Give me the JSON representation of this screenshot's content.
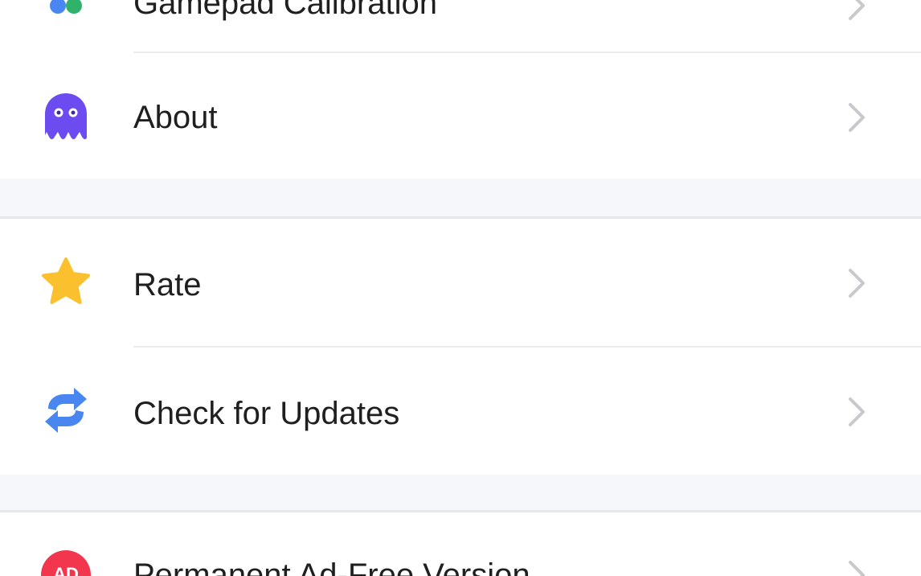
{
  "settings": {
    "rows": [
      {
        "label": "Gamepad Calibration",
        "icon": "gamepad-icon"
      },
      {
        "label": "About",
        "icon": "ghost-icon",
        "icon_color": "#6c4cf1"
      },
      {
        "label": "Rate",
        "icon": "star-icon",
        "icon_color": "#fbc02d"
      },
      {
        "label": "Check for Updates",
        "icon": "refresh-icon",
        "icon_color": "#4a86f0"
      },
      {
        "label": "Permanent Ad-Free Version",
        "icon": "ad-free-icon",
        "icon_color": "#f2364e"
      }
    ]
  },
  "colors": {
    "background": "#ffffff",
    "section_gap": "#f6f7fa",
    "divider": "#ececef",
    "label_text": "#1f1f1f",
    "chevron": "#c9c9cd"
  }
}
